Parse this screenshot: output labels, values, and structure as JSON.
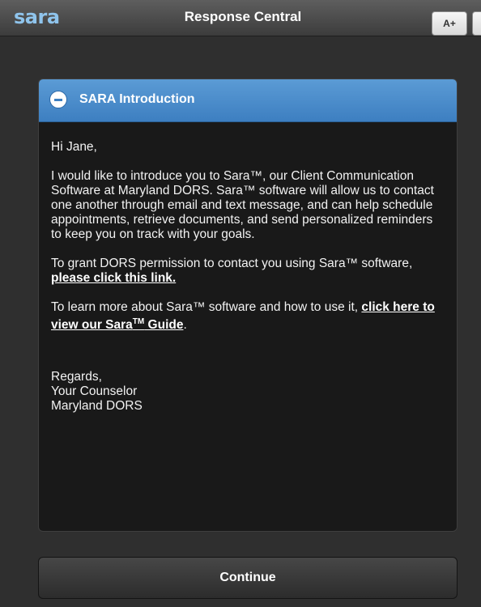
{
  "header": {
    "logo": "sara",
    "title": "Response Central",
    "font_size_button": "A+"
  },
  "panel": {
    "title": "SARA Introduction",
    "greeting": "Hi Jane,",
    "intro": "I would like to introduce you to Sara™, our Client Communication Software at Maryland DORS. Sara™ software will allow us to contact one another through email and text message, and can help schedule appointments, retrieve documents, and send personalized reminders to keep you on track with your goals.",
    "permission_text": "To grant DORS permission to contact you using Sara™ software, ",
    "permission_link": "please click this link.",
    "learn_text": "To learn more about Sara™ software and how to use it, ",
    "guide_link_part1": "click here to view our Sara",
    "guide_link_tm": "TM",
    "guide_link_part2": " Guide",
    "guide_suffix": ".",
    "signature": [
      "Regards,",
      "Your Counselor",
      "Maryland DORS"
    ]
  },
  "footer": {
    "continue_label": "Continue"
  },
  "colors": {
    "accent": "#4a8fd0",
    "logo": "#8fc4ec",
    "background": "#2f2f2f",
    "panel_body": "#191919"
  }
}
